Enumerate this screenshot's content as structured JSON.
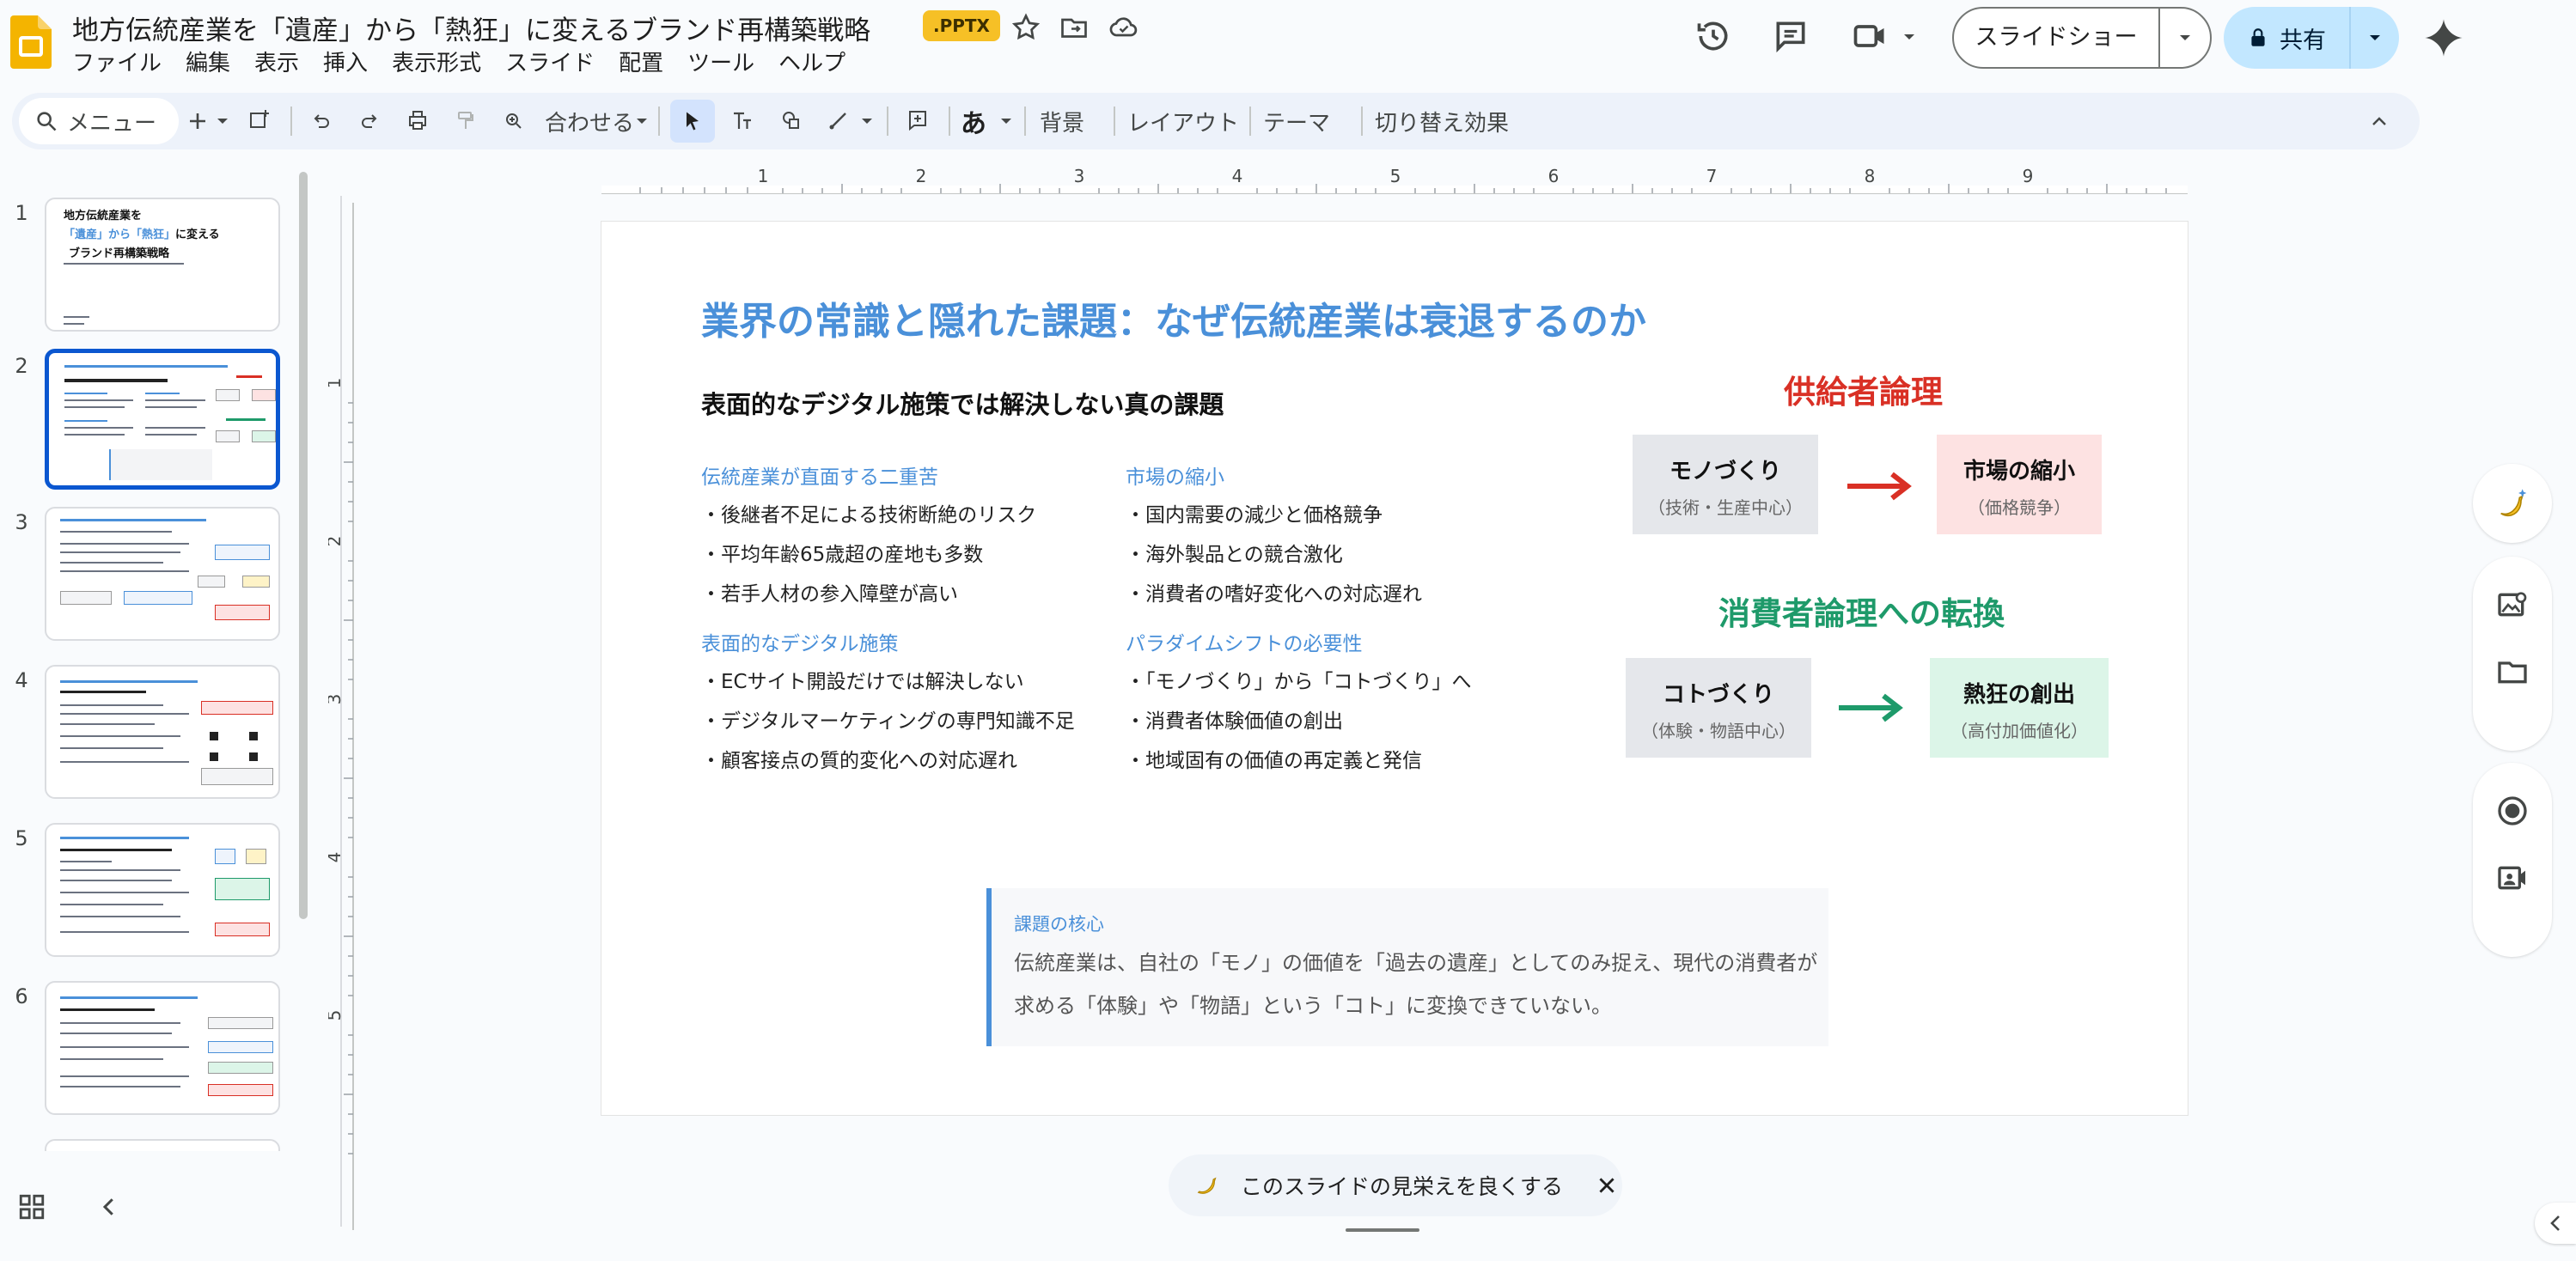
{
  "app": {
    "document_title": "地方伝統産業を「遺産」から「熱狂」に変えるブランド再構築戦略",
    "file_badge": ".PPTX",
    "menu": [
      "ファイル",
      "編集",
      "表示",
      "挿入",
      "表示形式",
      "スライド",
      "配置",
      "ツール",
      "ヘルプ"
    ],
    "slideshow_label": "スライドショー",
    "share_label": "共有"
  },
  "toolbar": {
    "menu_search": "メニュー",
    "zoom_label": "合わせる",
    "input_tools": "あ",
    "background": "背景",
    "layout": "レイアウト",
    "theme": "テーマ",
    "transition": "切り替え効果"
  },
  "ruler": {
    "h_ticks": [
      "1",
      "2",
      "3",
      "4",
      "5",
      "6",
      "7",
      "8",
      "9"
    ],
    "v_ticks": [
      "1",
      "2",
      "3",
      "4",
      "5"
    ]
  },
  "thumbnails": {
    "numbers": [
      "1",
      "2",
      "3",
      "4",
      "5",
      "6"
    ],
    "slide1": {
      "line1": "地方伝統産業を",
      "line2a": "「遺産」から「熱狂」",
      "line2b": "に変える",
      "line3": "ブランド再構築戦略"
    }
  },
  "slide": {
    "title": "業界の常識と隠れた課題：なぜ伝統産業は衰退するのか",
    "subtitle": "表面的なデジタル施策では解決しない真の課題",
    "sections": [
      {
        "heading": "伝統産業が直面する二重苦",
        "bullets": [
          "・後継者不足による技術断絶のリスク",
          "・平均年齢65歳超の産地も多数",
          "・若手人材の参入障壁が高い"
        ]
      },
      {
        "heading": "市場の縮小",
        "bullets": [
          "・国内需要の減少と価格競争",
          "・海外製品との競合激化",
          "・消費者の嗜好変化への対応遅れ"
        ]
      },
      {
        "heading": "表面的なデジタル施策",
        "bullets": [
          "・ECサイト開設だけでは解決しない",
          "・デジタルマーケティングの専門知識不足",
          "・顧客接点の質的変化への対応遅れ"
        ]
      },
      {
        "heading": "パラダイムシフトの必要性",
        "bullets": [
          "・「モノづくり」から「コトづくり」へ",
          "・消費者体験価値の創出",
          "・地域固有の価値の再定義と発信"
        ]
      }
    ],
    "supplier": {
      "label": "供給者論理",
      "from_main": "モノづくり",
      "from_sub": "（技術・生産中心）",
      "to_main": "市場の縮小",
      "to_sub": "（価格競争）",
      "color": "#d93025"
    },
    "consumer": {
      "label": "消費者論理への転換",
      "from_main": "コトづくり",
      "from_sub": "（体験・物語中心）",
      "to_main": "熱狂の創出",
      "to_sub": "（高付加価値化）",
      "color": "#1e9a6a"
    },
    "core": {
      "heading": "課題の核心",
      "text": "伝統産業は、自社の「モノ」の価値を「過去の遺産」としてのみ捉え、現代の消費者が求める「体験」や「物語」という「コト」に変換できていない。"
    }
  },
  "improve_chip": {
    "label": "このスライドの見栄えを良くする"
  },
  "colors": {
    "accent_blue": "#4a90d9",
    "share_bg": "#c2e7ff",
    "badge": "#f6c026"
  }
}
